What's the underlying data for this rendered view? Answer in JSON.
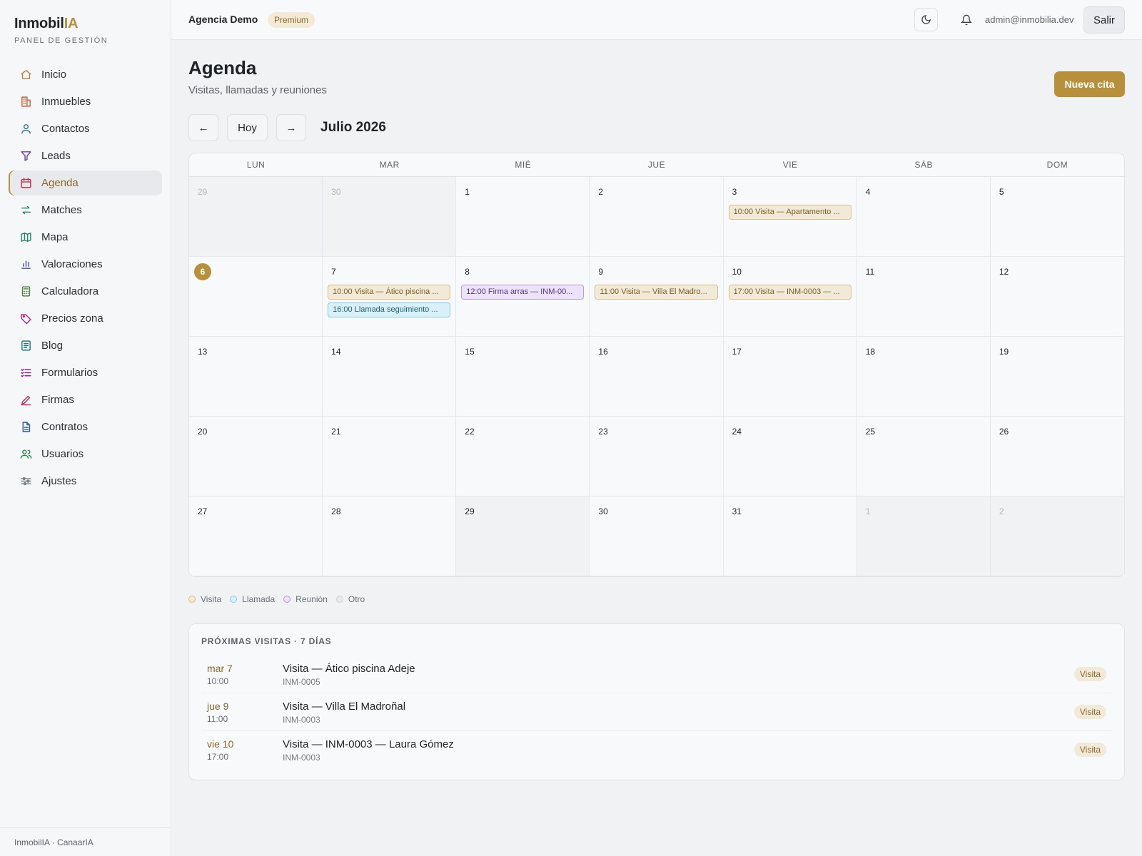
{
  "brand": {
    "name_main": "Inmobil",
    "name_accent": "IA",
    "subtitle": "PANEL DE GESTIÓN"
  },
  "sidebar": {
    "items": [
      {
        "label": "Inicio",
        "icon": "home-icon",
        "color": "#c0803a"
      },
      {
        "label": "Inmuebles",
        "icon": "building-icon",
        "color": "#c8643a"
      },
      {
        "label": "Contactos",
        "icon": "user-icon",
        "color": "#2b7a8c"
      },
      {
        "label": "Leads",
        "icon": "funnel-icon",
        "color": "#6a3fb0"
      },
      {
        "label": "Agenda",
        "icon": "calendar-icon",
        "color": "#c0304a"
      },
      {
        "label": "Matches",
        "icon": "arrows-swap-icon",
        "color": "#1d8a5a"
      },
      {
        "label": "Mapa",
        "icon": "map-icon",
        "color": "#1d8a6a"
      },
      {
        "label": "Valoraciones",
        "icon": "bar-chart-icon",
        "color": "#4b4fb0"
      },
      {
        "label": "Calculadora",
        "icon": "calculator-icon",
        "color": "#4a8a3a"
      },
      {
        "label": "Precios zona",
        "icon": "tag-icon",
        "color": "#b02a8a"
      },
      {
        "label": "Blog",
        "icon": "document-lines-icon",
        "color": "#1d7a7a"
      },
      {
        "label": "Formularios",
        "icon": "checklist-icon",
        "color": "#8a2aa0"
      },
      {
        "label": "Firmas",
        "icon": "pen-icon",
        "color": "#c02a5a"
      },
      {
        "label": "Contratos",
        "icon": "file-icon",
        "color": "#2a5ab0"
      },
      {
        "label": "Usuarios",
        "icon": "users-icon",
        "color": "#1d8a4a"
      },
      {
        "label": "Ajustes",
        "icon": "sliders-icon",
        "color": "#7a8088"
      }
    ],
    "active": "Agenda",
    "footer": "InmobilIA · CanaarIA"
  },
  "topbar": {
    "agency": "Agencia Demo",
    "plan": "Premium",
    "email": "admin@inmobilia.dev",
    "logout": "Salir"
  },
  "page": {
    "title": "Agenda",
    "subtitle": "Visitas, llamadas y reuniones",
    "new_button": "Nueva cita"
  },
  "calendar": {
    "prev": "←",
    "today_label": "Hoy",
    "next": "→",
    "month": "Julio 2026",
    "weekdays": [
      "LUN",
      "MAR",
      "MIÉ",
      "JUE",
      "VIE",
      "SÁB",
      "DOM"
    ],
    "days": [
      {
        "n": "29",
        "outside": true
      },
      {
        "n": "30",
        "outside": true
      },
      {
        "n": "1"
      },
      {
        "n": "2"
      },
      {
        "n": "3",
        "events": [
          {
            "type": "visita",
            "text": "10:00 Visita — Apartamento ..."
          }
        ]
      },
      {
        "n": "4"
      },
      {
        "n": "5"
      },
      {
        "n": "6",
        "today": true
      },
      {
        "n": "7",
        "events": [
          {
            "type": "visita",
            "text": "10:00 Visita — Ático piscina ..."
          },
          {
            "type": "llamada",
            "text": "16:00 Llamada seguimiento ..."
          }
        ]
      },
      {
        "n": "8",
        "events": [
          {
            "type": "reunion",
            "text": "12:00 Firma arras — INM-00..."
          }
        ]
      },
      {
        "n": "9",
        "events": [
          {
            "type": "visita",
            "text": "11:00 Visita — Villa El Madro..."
          }
        ]
      },
      {
        "n": "10",
        "events": [
          {
            "type": "visita",
            "text": "17:00 Visita — INM-0003 — ..."
          }
        ]
      },
      {
        "n": "11"
      },
      {
        "n": "12"
      },
      {
        "n": "13"
      },
      {
        "n": "14"
      },
      {
        "n": "15"
      },
      {
        "n": "16"
      },
      {
        "n": "17"
      },
      {
        "n": "18"
      },
      {
        "n": "19"
      },
      {
        "n": "20"
      },
      {
        "n": "21"
      },
      {
        "n": "22"
      },
      {
        "n": "23"
      },
      {
        "n": "24"
      },
      {
        "n": "25"
      },
      {
        "n": "26"
      },
      {
        "n": "27"
      },
      {
        "n": "28"
      },
      {
        "n": "29",
        "shaded": true
      },
      {
        "n": "30"
      },
      {
        "n": "31"
      },
      {
        "n": "1",
        "outside": true
      },
      {
        "n": "2",
        "outside": true
      }
    ]
  },
  "legend": [
    {
      "label": "Visita",
      "color": "#f2ead8",
      "border": "#d9bf87"
    },
    {
      "label": "Llamada",
      "color": "#d9f0f8",
      "border": "#83cde6"
    },
    {
      "label": "Reunión",
      "color": "#ebe3f7",
      "border": "#b79ae0"
    },
    {
      "label": "Otro",
      "color": "#e8e9eb",
      "border": "#cfd2d6"
    }
  ],
  "upcoming": {
    "title": "PRÓXIMAS VISITAS · 7 DÍAS",
    "items": [
      {
        "date": "mar 7",
        "time": "10:00",
        "title": "Visita — Ático piscina Adeje",
        "ref": "INM-0005",
        "badge": "Visita"
      },
      {
        "date": "jue 9",
        "time": "11:00",
        "title": "Visita — Villa El Madroñal",
        "ref": "INM-0003",
        "badge": "Visita"
      },
      {
        "date": "vie 10",
        "time": "17:00",
        "title": "Visita — INM-0003 — Laura Gómez",
        "ref": "INM-0003",
        "badge": "Visita"
      }
    ]
  }
}
